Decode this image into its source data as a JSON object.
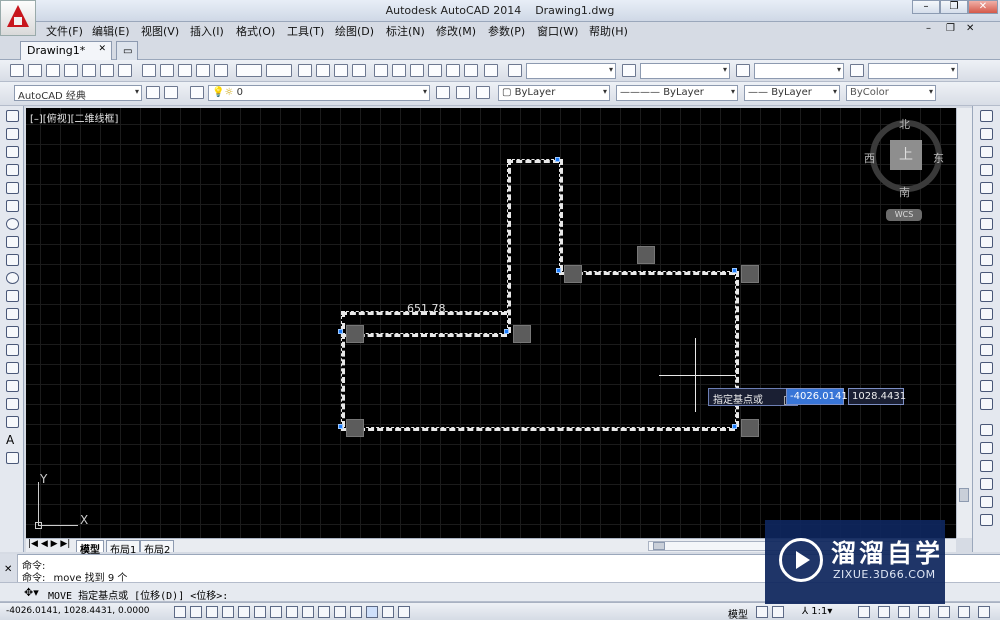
{
  "app": {
    "title": "Autodesk AutoCAD 2014",
    "file": "Drawing1.dwg"
  },
  "menu": [
    "文件(F)",
    "编辑(E)",
    "视图(V)",
    "插入(I)",
    "格式(O)",
    "工具(T)",
    "绘图(D)",
    "标注(N)",
    "修改(M)",
    "参数(P)",
    "窗口(W)",
    "帮助(H)"
  ],
  "doc_tab": "Drawing1*",
  "toolbar": {
    "workspace": "AutoCAD 经典",
    "layer": "0",
    "color": "ByLayer",
    "linetype": "ByLayer",
    "lineweight": "ByLayer",
    "plotstyle": "ByColor"
  },
  "viewport": {
    "label": "[–][俯视][二维线框]",
    "dimension": "651.78",
    "tooltip": "指定基点或",
    "coord_x": "-4026.0141",
    "coord_y": "1028.4431"
  },
  "navcube": {
    "north": "北",
    "south": "南",
    "east": "东",
    "west": "西",
    "top": "上",
    "wcs": "WCS"
  },
  "ucs": {
    "x": "X",
    "y": "Y"
  },
  "layout_tabs": [
    "模型",
    "布局1",
    "布局2"
  ],
  "command": {
    "line1": "命令:",
    "line2": "命令: _move 找到 9 个",
    "prompt": "MOVE 指定基点或 [位移(D)] <位移>:"
  },
  "status": {
    "coords": "-4026.0141, 1028.4431, 0.0000",
    "model": "模型",
    "scale": "1:1"
  },
  "watermark": {
    "title": "溜溜自学",
    "sub": "ZIXUE.3D66.COM"
  }
}
